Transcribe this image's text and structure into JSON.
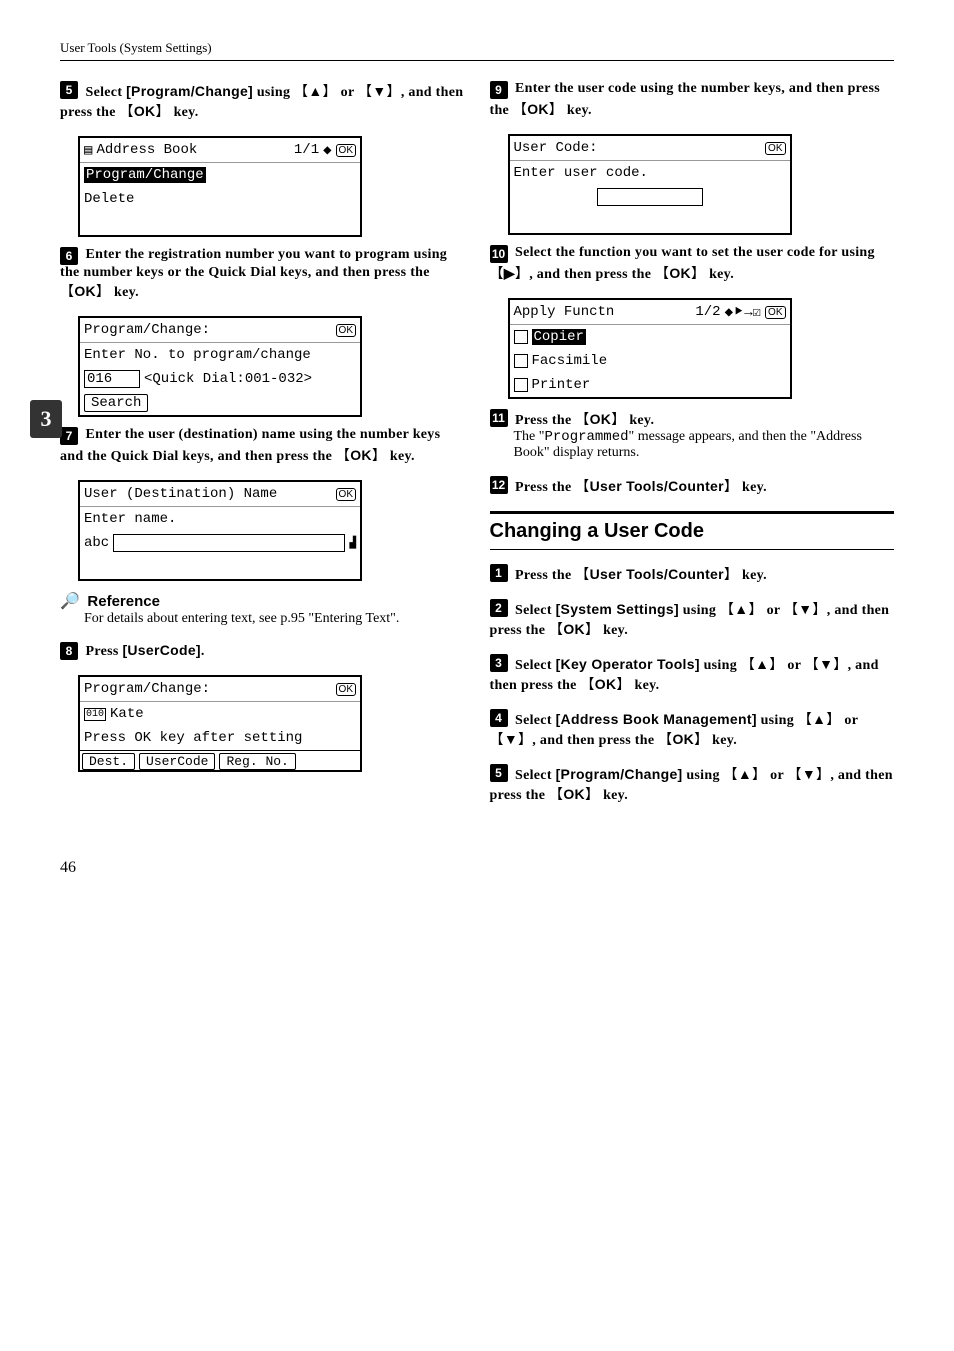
{
  "header": "User Tools (System Settings)",
  "side_tab": "3",
  "page_number": "46",
  "left": {
    "step5": {
      "pre": "Select ",
      "bold1": "[Program/Change]",
      "mid1": " using ",
      "key1": "▲",
      "mid2": " or ",
      "key2": "▼",
      "mid3": ", and then press the ",
      "key3": "OK",
      "post": " key."
    },
    "lcd1": {
      "title": "Address Book",
      "page": "1/1",
      "row1": "Program/Change",
      "row2": "Delete"
    },
    "step6": "Enter the registration number you want to program using the number keys or the Quick Dial keys, and then press the ",
    "step6_key": "OK",
    "step6_post": " key.",
    "lcd2": {
      "title": "Program/Change:",
      "row1": "Enter No. to program/change",
      "num": "016",
      "range": "<Quick Dial:001-032>",
      "search": "Search"
    },
    "step7": "Enter the user (destination) name using the number keys and the Quick Dial keys, and then press the ",
    "step7_key": "OK",
    "step7_post": " key.",
    "lcd3": {
      "title": "User (Destination) Name",
      "row1": "Enter name.",
      "mode": "abc"
    },
    "reference": {
      "title": "Reference",
      "body": "For details about entering text, see p.95 \"Entering Text\"."
    },
    "step8": {
      "pre": "Press ",
      "bold": "[UserCode]",
      "post": "."
    },
    "lcd4": {
      "title": "Program/Change:",
      "num": "010",
      "name": "Kate",
      "row2": "Press OK key after setting",
      "tab1": "Dest.",
      "tab2": "UserCode",
      "tab3": "Reg. No."
    }
  },
  "right": {
    "step9": "Enter the user code using the number keys, and then press the ",
    "step9_key": "OK",
    "step9_post": " key.",
    "lcd5": {
      "title": "User Code:",
      "row1": "Enter user code."
    },
    "step10": "Select the function you want to set the user code for using ",
    "step10_key1": "▶",
    "step10_mid": ", and then press the ",
    "step10_key2": "OK",
    "step10_post": " key.",
    "lcd6": {
      "title": "Apply Functn",
      "page": "1/2",
      "opt1": "Copier",
      "opt2": "Facsimile",
      "opt3": "Printer"
    },
    "step11": {
      "pre": "Press the ",
      "key": "OK",
      "post": " key."
    },
    "step11_body_pre": "The \"",
    "step11_body_mono": "Programmed",
    "step11_body_post": "\" message appears, and then the \"Address Book\" display returns.",
    "step12": {
      "pre": "Press the ",
      "key": "User Tools/Counter",
      "post": " key."
    },
    "section": "Changing a User Code",
    "c_step1": {
      "pre": "Press the ",
      "key": "User Tools/Counter",
      "post": " key."
    },
    "c_step2": {
      "pre": "Select ",
      "bold": "[System Settings]",
      "mid1": " using ",
      "k1": "▲",
      "mid2": " or ",
      "k2": "▼",
      "mid3": ", and then press the ",
      "k3": "OK",
      "post": " key."
    },
    "c_step3": {
      "pre": "Select ",
      "bold": "[Key Operator Tools]",
      "mid1": " using ",
      "k1": "▲",
      "mid2": " or ",
      "k2": "▼",
      "mid3": ", and then press the ",
      "k3": "OK",
      "post": " key."
    },
    "c_step4": {
      "pre": "Select ",
      "bold": "[Address Book Management]",
      "mid1": " using ",
      "k1": "▲",
      "mid2": " or ",
      "k2": "▼",
      "mid3": ", and then press the ",
      "k3": "OK",
      "post": " key."
    },
    "c_step5": {
      "pre": "Select ",
      "bold": "[Program/Change]",
      "mid1": " using ",
      "k1": "▲",
      "mid2": " or ",
      "k2": "▼",
      "mid3": ", and then press the ",
      "k3": "OK",
      "post": " key."
    }
  }
}
